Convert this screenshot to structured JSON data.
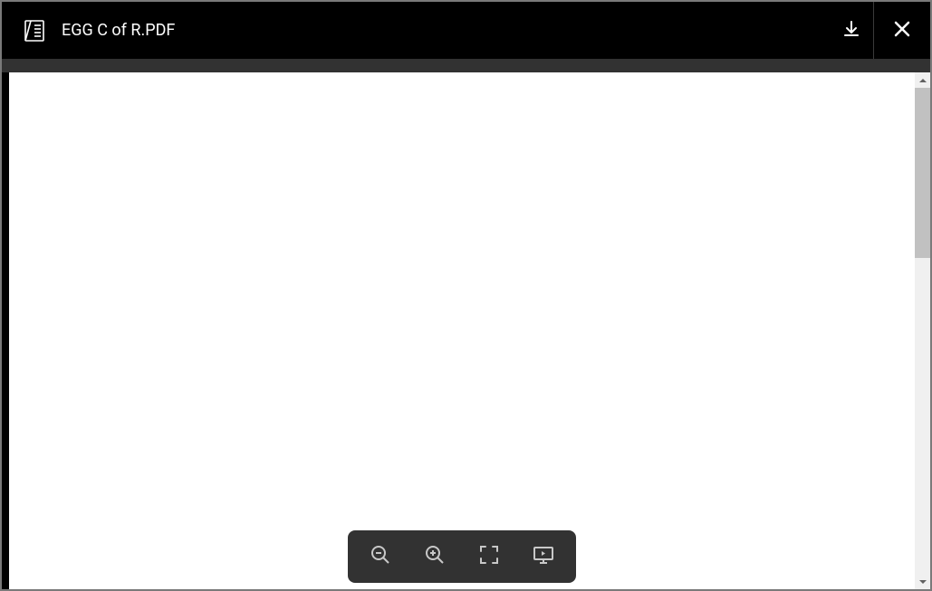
{
  "header": {
    "title": "EGG C of R.PDF"
  }
}
